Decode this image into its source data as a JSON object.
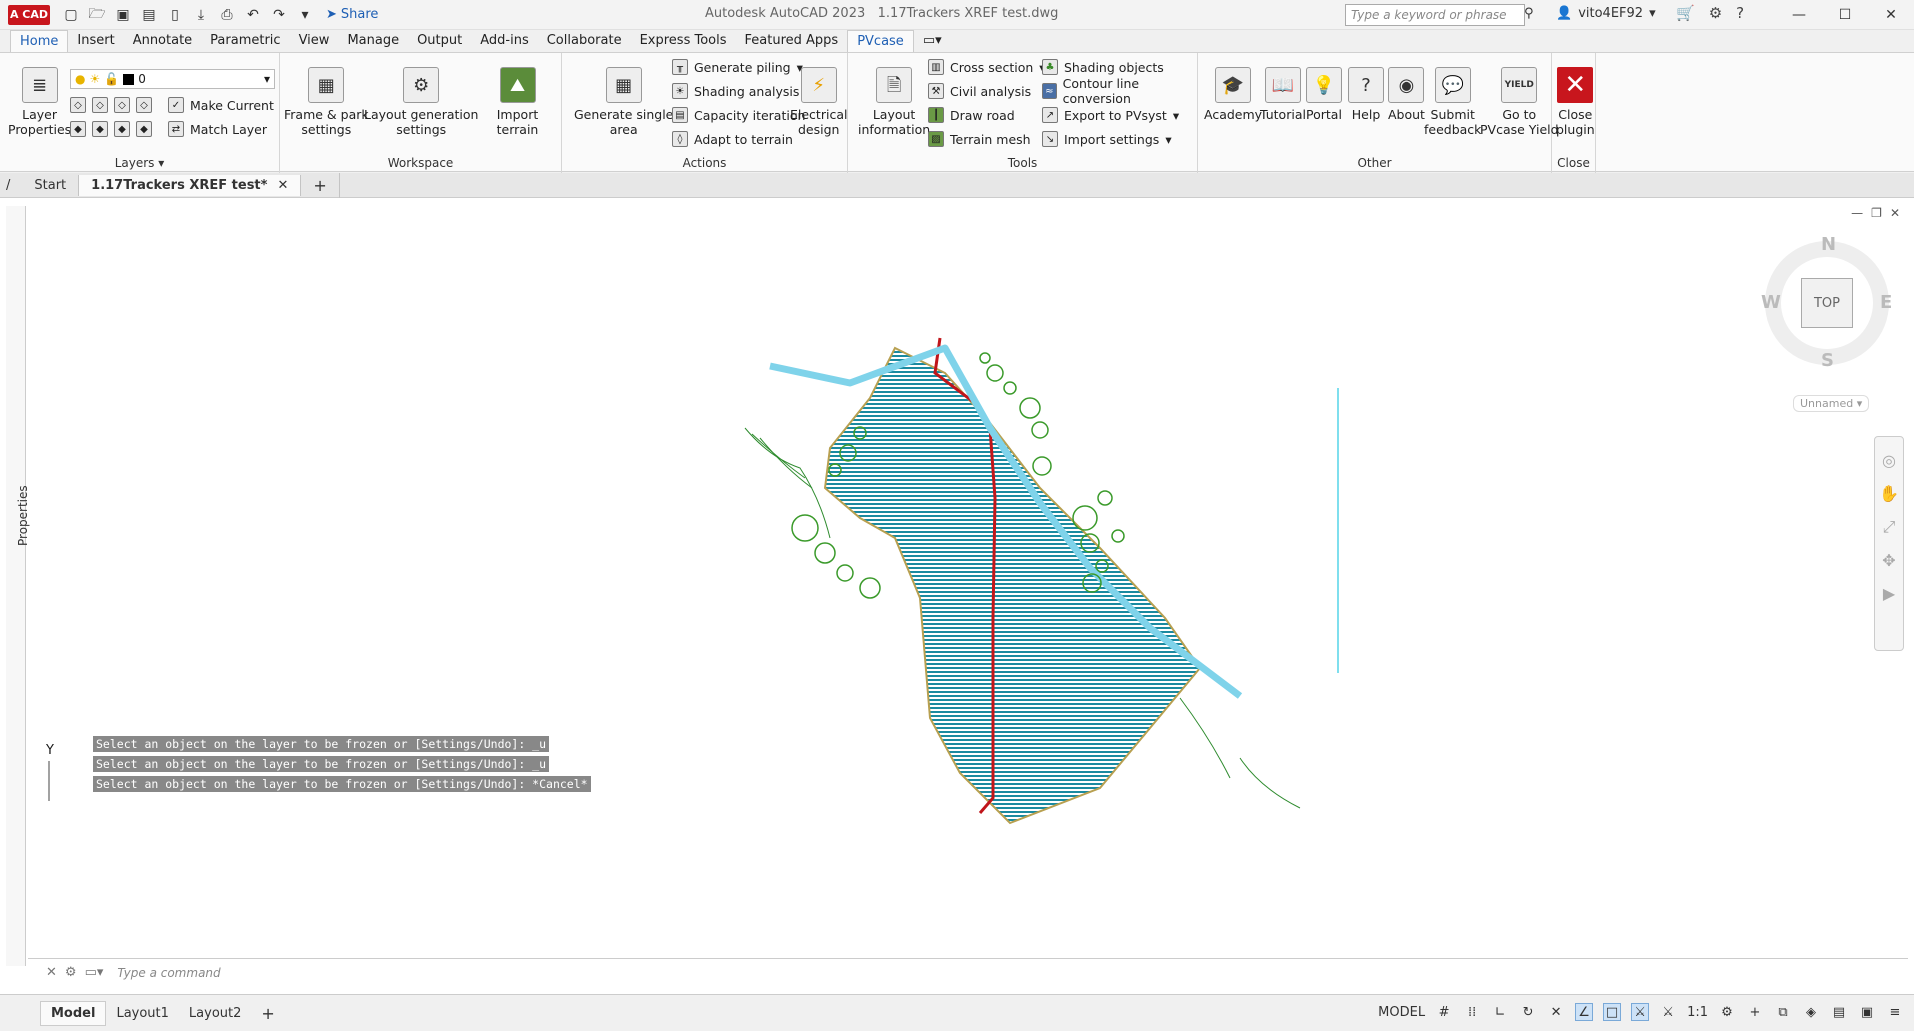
{
  "titlebar": {
    "logo": "A CAD",
    "share_label": "Share",
    "app_title": "Autodesk AutoCAD 2023",
    "file_title": "1.17Trackers XREF test.dwg",
    "search_placeholder": "Type a keyword or phrase",
    "user": "vito4EF92"
  },
  "ribbon_tabs": [
    "Home",
    "Insert",
    "Annotate",
    "Parametric",
    "View",
    "Manage",
    "Output",
    "Add-ins",
    "Collaborate",
    "Express Tools",
    "Featured Apps",
    "PVcase"
  ],
  "ribbon": {
    "layers": {
      "title": "Layers",
      "layer_properties": "Layer\nProperties",
      "current_layer": "0",
      "make_current": "Make Current",
      "match_layer": "Match Layer"
    },
    "workspace": {
      "title": "Workspace",
      "frame_park": "Frame & park\nsettings",
      "layout_gen": "Layout generation\nsettings",
      "import_terrain": "Import terrain"
    },
    "actions": {
      "title": "Actions",
      "generate_single": "Generate single\narea",
      "generate_piling": "Generate piling",
      "shading_analysis": "Shading analysis",
      "capacity_iteration": "Capacity iteration",
      "adapt_terrain": "Adapt to terrain",
      "electrical_design": "Electrical\ndesign"
    },
    "tools": {
      "title": "Tools",
      "layout_info": "Layout\ninformation",
      "cross_section": "Cross section",
      "civil_analysis": "Civil analysis",
      "draw_road": "Draw road",
      "terrain_mesh": "Terrain mesh",
      "shading_objects": "Shading objects",
      "contour_conversion": "Contour line conversion",
      "export_pvsyst": "Export to PVsyst",
      "import_settings": "Import settings"
    },
    "other": {
      "title": "Other",
      "academy": "Academy",
      "tutorial": "Tutorial",
      "portal": "Portal",
      "help": "Help",
      "about": "About",
      "submit_feedback": "Submit\nfeedback",
      "go_yield": "Go to\nPVcase Yield"
    },
    "close": {
      "title": "Close",
      "close_plugin": "Close\nplugin"
    }
  },
  "doc_tabs": {
    "start": "Start",
    "active": "1.17Trackers XREF test*"
  },
  "canvas": {
    "properties_label": "Properties",
    "viewcube": {
      "top": "TOP",
      "n": "N",
      "s": "S",
      "e": "E",
      "w": "W"
    },
    "named_view": "Unnamed",
    "ucs_y": "Y"
  },
  "command": {
    "history": [
      "Select an object on the layer to be frozen or [Settings/Undo]: _u",
      "Select an object on the layer to be frozen or [Settings/Undo]: _u",
      "Select an object on the layer to be frozen or [Settings/Undo]: *Cancel*"
    ],
    "placeholder": "Type a command"
  },
  "statusbar": {
    "layout_tabs": [
      "Model",
      "Layout1",
      "Layout2"
    ],
    "model_label": "MODEL",
    "scale": "1:1"
  }
}
